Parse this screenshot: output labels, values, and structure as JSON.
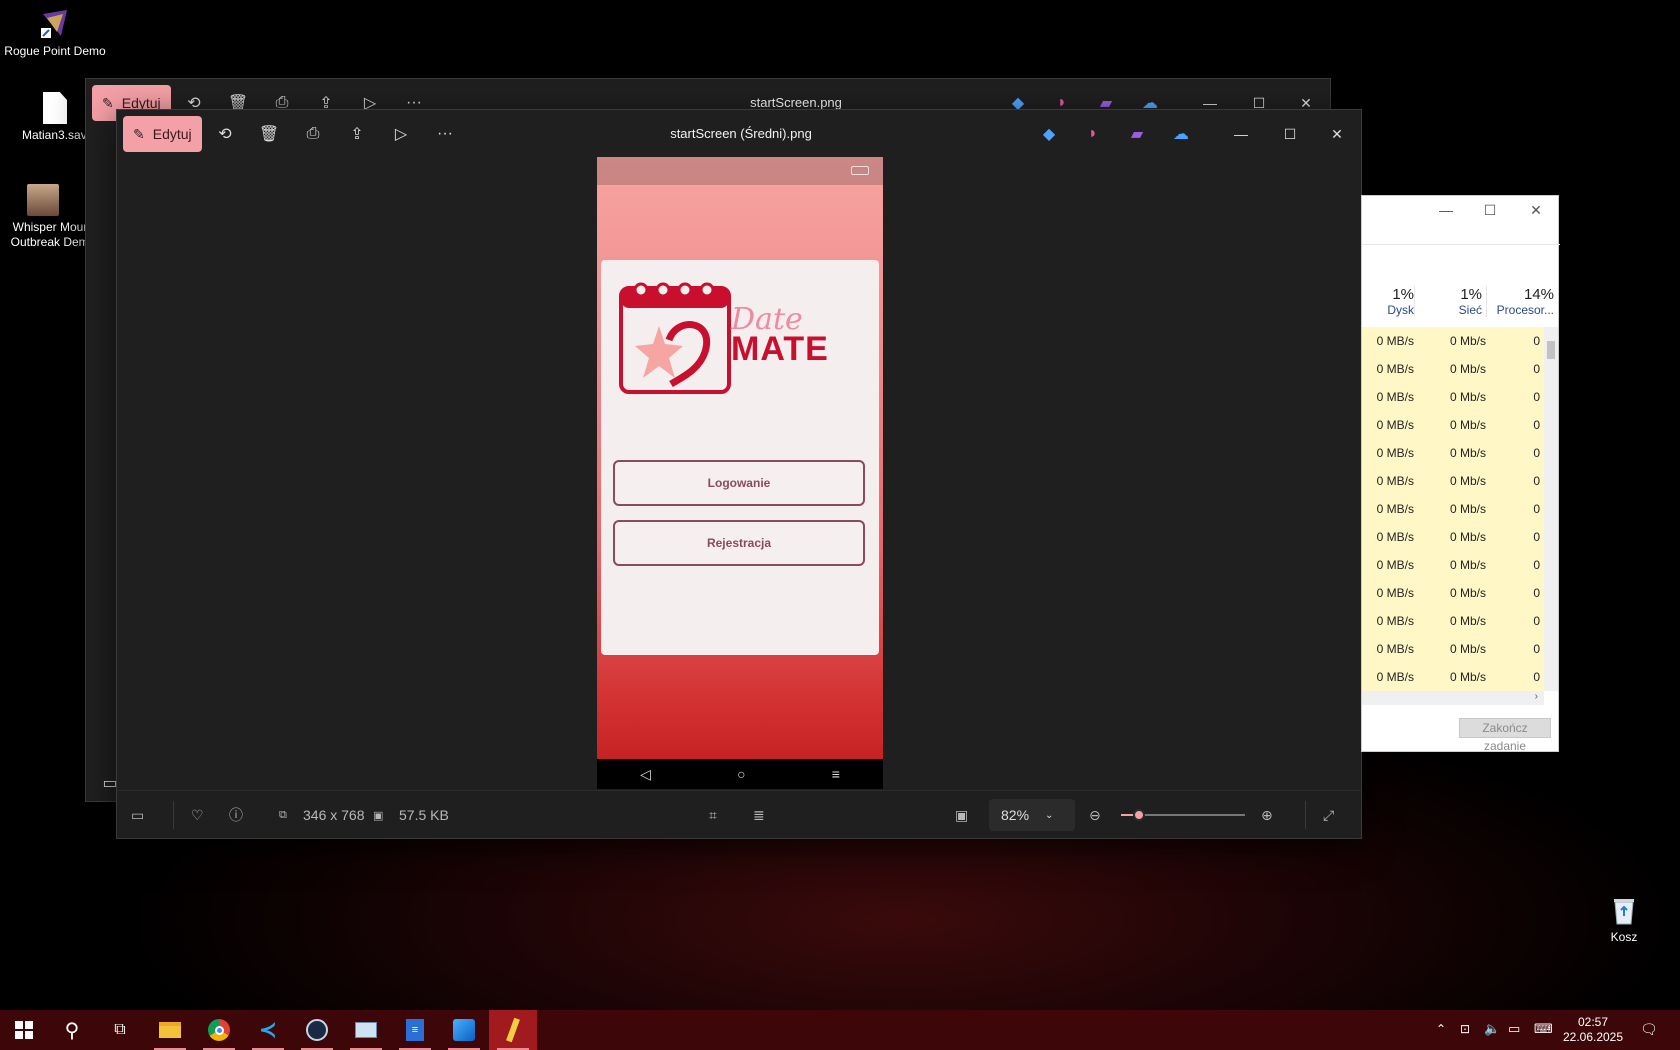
{
  "desktop": {
    "icons": [
      {
        "label": "Rogue Point Demo",
        "icon": "game-shortcut-icon"
      },
      {
        "label": "Matian3.save",
        "icon": "file-icon"
      },
      {
        "label": "Whisper Mount Outbreak Demo",
        "icon": "game-shortcut-icon"
      },
      {
        "label": "Kosz",
        "icon": "recycle-bin-icon"
      }
    ]
  },
  "back_window": {
    "title": "startScreen.png",
    "edit_label": "Edytuj"
  },
  "front_window": {
    "title": "startScreen (Średni).png",
    "edit_label": "Edytuj",
    "status": {
      "dimensions": "346 x 768",
      "filesize": "57.5 KB",
      "zoom": "82%",
      "zoom_level": 0.1
    }
  },
  "phone_app": {
    "logo_script": "Date",
    "logo_word": "MATE",
    "login_label": "Logowanie",
    "register_label": "Rejestracja",
    "battery": "battery-icon"
  },
  "task_manager": {
    "columns": [
      {
        "percent": "1%",
        "name": "Dysk"
      },
      {
        "percent": "1%",
        "name": "Sieć"
      },
      {
        "percent": "14%",
        "name": "Procesor..."
      }
    ],
    "rows": [
      [
        "0 MB/s",
        "0 Mb/s",
        "0"
      ],
      [
        "0 MB/s",
        "0 Mb/s",
        "0"
      ],
      [
        "0 MB/s",
        "0 Mb/s",
        "0"
      ],
      [
        "0 MB/s",
        "0 Mb/s",
        "0"
      ],
      [
        "0 MB/s",
        "0 Mb/s",
        "0"
      ],
      [
        "0 MB/s",
        "0 Mb/s",
        "0"
      ],
      [
        "0 MB/s",
        "0 Mb/s",
        "0"
      ],
      [
        "0 MB/s",
        "0 Mb/s",
        "0"
      ],
      [
        "0 MB/s",
        "0 Mb/s",
        "0"
      ],
      [
        "0 MB/s",
        "0 Mb/s",
        "0"
      ],
      [
        "0 MB/s",
        "0 Mb/s",
        "0"
      ],
      [
        "0 MB/s",
        "0 Mb/s",
        "0"
      ],
      [
        "0 MB/s",
        "0 Mb/s",
        "0"
      ]
    ],
    "end_task_label": "Zakończ zadanie"
  },
  "taskbar": {
    "time": "02:57",
    "date": "22.06.2025",
    "apps": [
      "start-icon",
      "search-icon",
      "task-view-icon",
      "file-explorer-icon",
      "chrome-icon",
      "vscode-icon",
      "steam-icon",
      "task-manager-icon",
      "word-icon",
      "photos-icon",
      "app-icon"
    ]
  },
  "colors": {
    "accent": "#f3a0a6",
    "taskbar": "#3d0709",
    "card_button_text": "#8a4a62",
    "logo_red": "#c8102e"
  }
}
